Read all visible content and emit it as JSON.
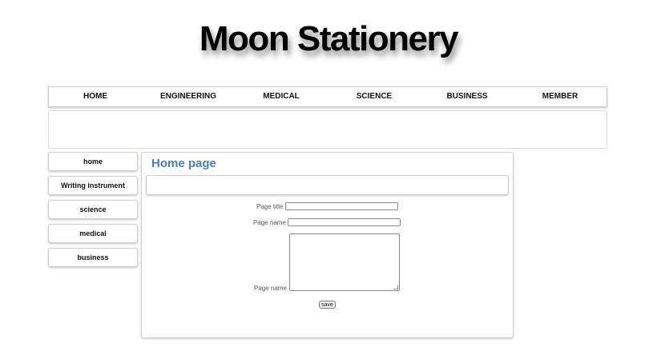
{
  "site": {
    "title": "Moon Stationery"
  },
  "top_nav": {
    "items": [
      "HOME",
      "ENGINEERING",
      "MEDICAL",
      "SCIENCE",
      "BUSINESS",
      "MEMBER"
    ]
  },
  "side_menu": {
    "items": [
      "home",
      "Writing instrument",
      "science",
      "medical",
      "business"
    ]
  },
  "content": {
    "title": "Home page",
    "form": {
      "page_title_label": "Page title",
      "page_title_value": "",
      "page_name_label": "Page name",
      "page_name_value": "",
      "page_body_label": "Page name",
      "page_body_value": "",
      "save_label": "save"
    }
  }
}
